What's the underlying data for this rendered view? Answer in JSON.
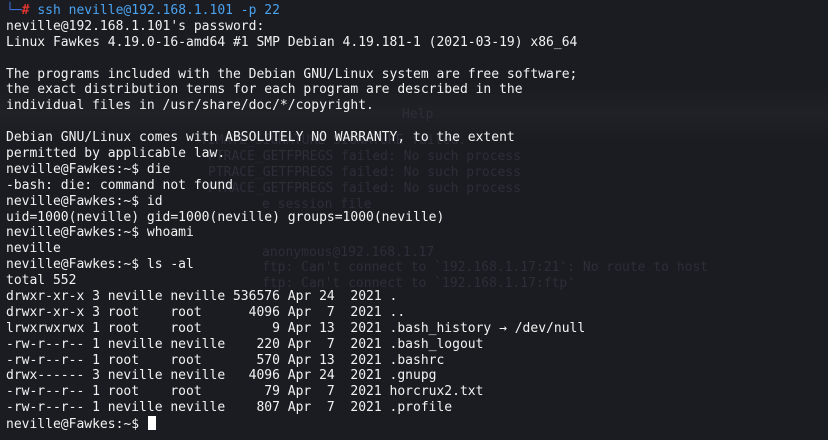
{
  "ssh_command": {
    "corner_glyph": "└─",
    "prompt_symbol": "#",
    "command": "ssh",
    "args": " neville@192.168.1.101 -p 22"
  },
  "output_lines": [
    "neville@192.168.1.101's password:",
    "Linux Fawkes 4.19.0-16-amd64 #1 SMP Debian 4.19.181-1 (2021-03-19) x86_64",
    "",
    "The programs included with the Debian GNU/Linux system are free software;",
    "the exact distribution terms for each program are described in the",
    "individual files in /usr/share/doc/*/copyright.",
    "",
    "Debian GNU/Linux comes with ABSOLUTELY NO WARRANTY, to the extent",
    "permitted by applicable law.",
    "neville@Fawkes:~$ die",
    "-bash: die: command not found",
    "neville@Fawkes:~$ id",
    "uid=1000(neville) gid=1000(neville) groups=1000(neville)",
    "neville@Fawkes:~$ whoami",
    "neville",
    "neville@Fawkes:~$ ls -al",
    "total 552",
    "drwxr-xr-x 3 neville neville 536576 Apr 24  2021 .",
    "drwxr-xr-x 3 root    root      4096 Apr  7  2021 ..",
    "lrwxrwxrwx 1 root    root         9 Apr 13  2021 .bash_history → /dev/null",
    "-rw-r--r-- 1 neville neville    220 Apr  7  2021 .bash_logout",
    "-rw-r--r-- 1 root    root       570 Apr 13  2021 .bashrc",
    "drwx------ 3 neville neville   4096 Apr 24  2021 .gnupg",
    "-rw-r--r-- 1 root    root        79 Apr  7  2021 horcrux2.txt",
    "-rw-r--r-- 1 neville neville    807 Apr  7  2021 .profile"
  ],
  "final_prompt": "neville@Fawkes:~$ ",
  "background_ghost_lines": [
    "Help",
    "TIMATE_SIGNATURE SIGNATURE failed.",
    "PTRACE_GETFPREGS failed: No such process",
    "PTRACE_GETFPREGS failed: No such process",
    "PTRACE_GETFPREGS failed: No such process",
    "e session file",
    "anonymous@192.168.1.17",
    "ftp: Can't connect to `192.168.1.17:21': No route to host",
    "ftp: Can't connect to `192.168.1.17:ftp'"
  ],
  "colors": {
    "background": "#1b1c22",
    "text": "#f2f2f2",
    "command_blue": "#4aa3f0",
    "root_red": "#e0342f",
    "corner_blue": "#3b6fd8"
  }
}
